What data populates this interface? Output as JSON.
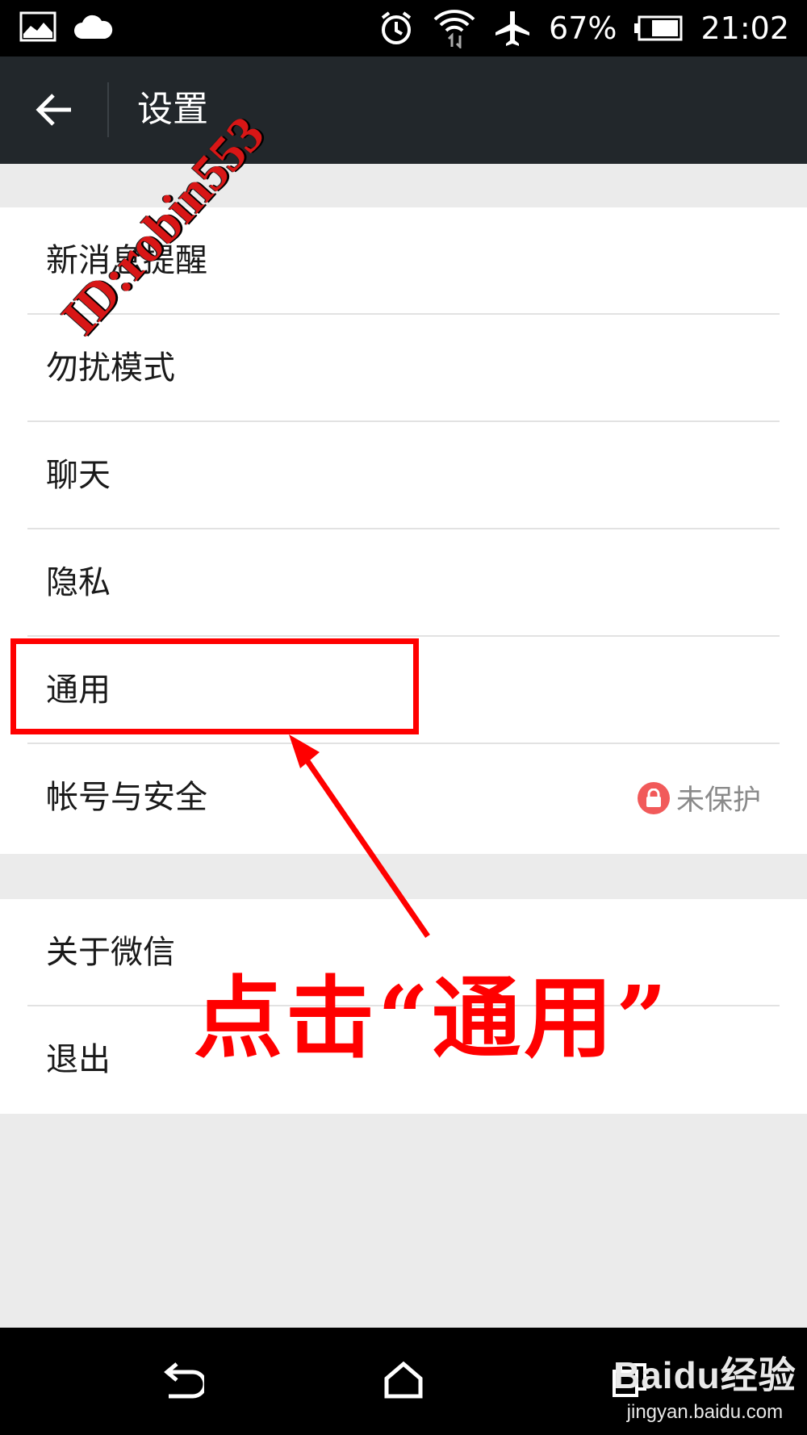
{
  "status_bar": {
    "battery_percent": "67%",
    "time": "21:02",
    "icons": [
      "gallery-icon",
      "cloud-icon",
      "alarm-icon",
      "wifi-icon",
      "airplane-icon",
      "battery-icon"
    ]
  },
  "header": {
    "title": "设置",
    "back_icon": "arrow-left-icon"
  },
  "settings": {
    "group1": [
      {
        "label": "新消息提醒"
      },
      {
        "label": "勿扰模式"
      },
      {
        "label": "聊天"
      },
      {
        "label": "隐私"
      },
      {
        "label": "通用"
      },
      {
        "label": "帐号与安全",
        "status": "未保护"
      }
    ],
    "group2": [
      {
        "label": "关于微信"
      },
      {
        "label": "退出"
      }
    ]
  },
  "annotation": {
    "text": "点击“通用”",
    "highlight_color": "#ff0000"
  },
  "watermark": {
    "text": "ID:robin553"
  },
  "nav_bar": {
    "icons": [
      "back-nav-icon",
      "home-nav-icon",
      "recent-apps-icon"
    ]
  },
  "branding": {
    "logo_text": "Baidu经验",
    "url": "jingyan.baidu.com"
  },
  "colors": {
    "action_bar": "#22272b",
    "background": "#ebebeb",
    "annotation": "#ff0000",
    "lock_badge": "#f15a5a"
  }
}
